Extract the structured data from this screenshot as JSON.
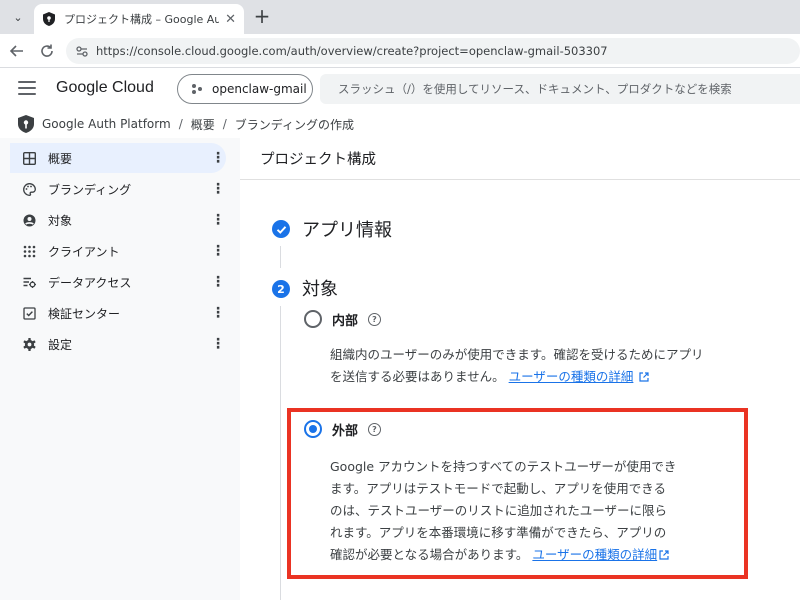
{
  "browser": {
    "tab_title": "プロジェクト構成 – Google Auth Platfo",
    "url": "https://console.cloud.google.com/auth/overview/create?project=openclaw-gmail-503307"
  },
  "header": {
    "brand": "Google Cloud",
    "project": "openclaw-gmail",
    "search_placeholder": "スラッシュ（/）を使用してリソース、ドキュメント、プロダクトなどを検索"
  },
  "breadcrumb": {
    "items": [
      "Google Auth Platform",
      "概要",
      "ブランディングの作成"
    ],
    "separator": "/"
  },
  "sidebar": {
    "items": [
      {
        "label": "概要",
        "icon": "dashboard-icon",
        "active": true
      },
      {
        "label": "ブランディング",
        "icon": "palette-icon",
        "active": false
      },
      {
        "label": "対象",
        "icon": "account-circle-icon",
        "active": false
      },
      {
        "label": "クライアント",
        "icon": "grid-apps-icon",
        "active": false
      },
      {
        "label": "データアクセス",
        "icon": "data-access-icon",
        "active": false
      },
      {
        "label": "検証センター",
        "icon": "verified-check-icon",
        "active": false
      },
      {
        "label": "設定",
        "icon": "gear-icon",
        "active": false
      }
    ]
  },
  "main": {
    "page_title": "プロジェクト構成",
    "step1": {
      "title": "アプリ情報",
      "status": "complete"
    },
    "step2": {
      "number": "2",
      "title": "対象"
    },
    "options": {
      "internal": {
        "label": "内部",
        "checked": false,
        "description": "組織内のユーザーのみが使用できます。確認を受けるためにアプリを送信する必要はありません。",
        "link": "ユーザーの種類の詳細"
      },
      "external": {
        "label": "外部",
        "checked": true,
        "description_lines": [
          "Google アカウントを持つすべてのテストユーザーが使用でき",
          "ます。アプリはテストモードで起動し、アプリを使用できる",
          "のは、テストユーザーのリストに追加されたユーザーに限ら",
          "れます。アプリを本番環境に移す準備ができたら、アプリの",
          "確認が必要となる場合があります。"
        ],
        "link": "ユーザーの種類の詳細"
      }
    }
  },
  "colors": {
    "accent": "#1a73e8",
    "highlight": "#ea3323",
    "sidebar_active": "#e8f0fe"
  }
}
